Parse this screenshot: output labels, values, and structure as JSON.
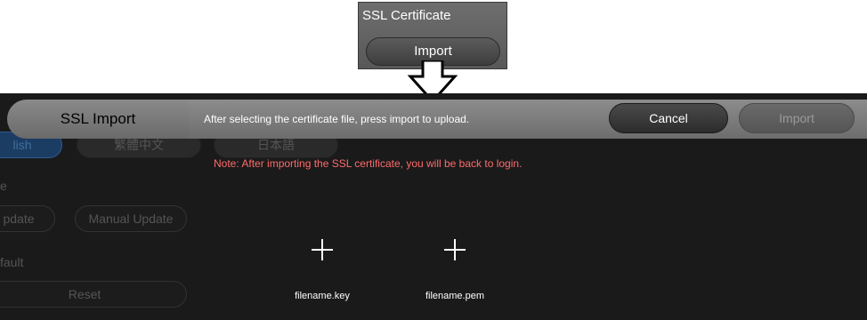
{
  "callout": {
    "title": "SSL Certificate",
    "import_label": "Import"
  },
  "background": {
    "lang_english": "lish",
    "lang_traditional": "繁體中文",
    "lang_japanese": "日本語",
    "section_e": "e",
    "update_label": "pdate",
    "manual_update_label": "Manual Update",
    "default_label": "fault",
    "reset_label": "Reset"
  },
  "header": {
    "title": "SSL Import",
    "message": "After selecting the certificate file, press import to upload.",
    "cancel_label": "Cancel",
    "import_label": "Import"
  },
  "note": "Note: After importing the SSL certificate, you will be back to login.",
  "files": [
    {
      "name": "filename.key",
      "icon": "plus-icon"
    },
    {
      "name": "filename.pem",
      "icon": "plus-icon"
    }
  ],
  "colors": {
    "note": "#ff6b6b",
    "accent_blue": "#2a6db0"
  }
}
